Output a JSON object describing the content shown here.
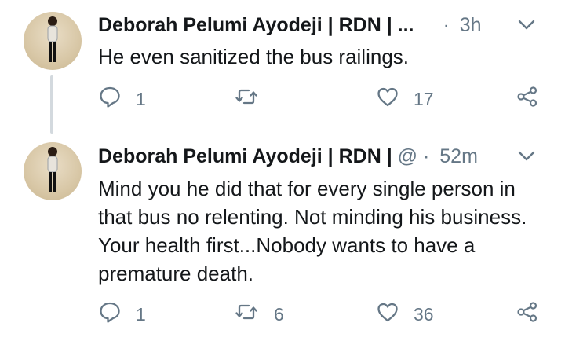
{
  "tweets": [
    {
      "author_name": "Deborah Pelumi Ayodeji | RDN | ...",
      "handle": "",
      "separator": "·",
      "time": "3h",
      "text": "He even sanitized the bus railings.",
      "replies": "1",
      "retweets": "",
      "likes": "17"
    },
    {
      "author_name": "Deborah Pelumi Ayodeji | RDN |",
      "handle": "@",
      "separator": "·",
      "time": "52m",
      "text": "Mind you he did that for every single person in that bus no relenting. Not minding his business. Your health first...Nobody wants to have a premature death.",
      "replies": "1",
      "retweets": "6",
      "likes": "36"
    }
  ],
  "icons": {
    "reply": "reply-icon",
    "retweet": "retweet-icon",
    "like": "heart-icon",
    "share": "share-icon",
    "more": "chevron-down-icon"
  },
  "colors": {
    "text": "#14171a",
    "secondary": "#657786",
    "thread_line": "#d3d9de"
  }
}
